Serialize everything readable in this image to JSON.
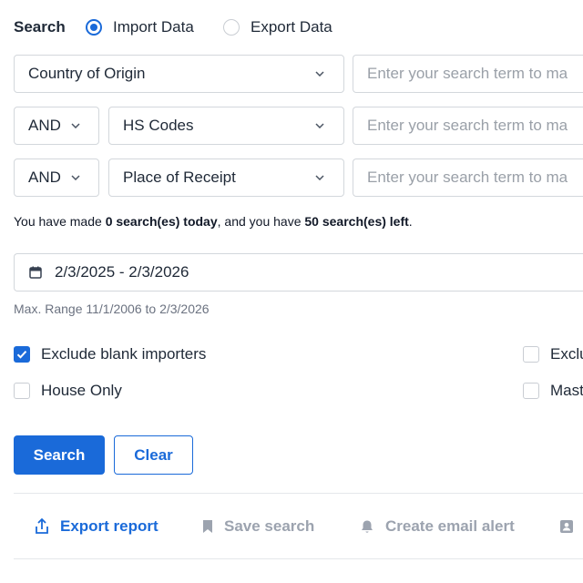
{
  "search_mode": {
    "label": "Search",
    "options": [
      {
        "label": "Import Data",
        "selected": true
      },
      {
        "label": "Export Data",
        "selected": false
      }
    ]
  },
  "rows": [
    {
      "operator": null,
      "field": "Country of Origin",
      "placeholder": "Enter your search term to ma"
    },
    {
      "operator": "AND",
      "field": "HS Codes",
      "placeholder": "Enter your search term to ma"
    },
    {
      "operator": "AND",
      "field": "Place of Receipt",
      "placeholder": "Enter your search term to ma"
    }
  ],
  "quota": {
    "prefix": "You have made ",
    "made": "0 search(es) today",
    "middle": ", and you have ",
    "left": "50 search(es) left",
    "suffix": "."
  },
  "date_range": {
    "value": "2/3/2025 - 2/3/2026",
    "hint": "Max. Range 11/1/2006 to 2/3/2026",
    "icon": "calendar-icon"
  },
  "options": [
    {
      "label": "Exclude blank importers",
      "checked": true
    },
    {
      "label": "Exclu",
      "checked": false
    },
    {
      "label": "House Only",
      "checked": false
    },
    {
      "label": "Mast",
      "checked": false
    }
  ],
  "buttons": {
    "search": "Search",
    "clear": "Clear"
  },
  "actions": [
    {
      "label": "Export report",
      "icon": "share-icon",
      "enabled": true
    },
    {
      "label": "Save search",
      "icon": "bookmark-icon",
      "enabled": false
    },
    {
      "label": "Create email alert",
      "icon": "bell-icon",
      "enabled": false
    },
    {
      "label": "",
      "icon": "contact-card-icon",
      "enabled": false
    }
  ],
  "colors": {
    "accent": "#1a6ad9",
    "border": "#d3d7dc",
    "muted": "#9ca3af"
  }
}
